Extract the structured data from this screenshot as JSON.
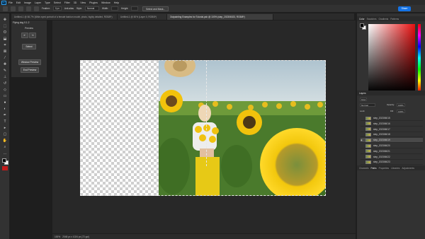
{
  "menubar": {
    "items": [
      "File",
      "Edit",
      "Image",
      "Layer",
      "Type",
      "Select",
      "Filter",
      "3D",
      "View",
      "Plugins",
      "Window",
      "Help"
    ]
  },
  "options": {
    "feather_label": "Feather:",
    "feather_value": "0 px",
    "antialias_label": "Anti-alias",
    "style_label": "Style:",
    "style_value": "Normal",
    "width_label": "Width:",
    "height_label": "Height:",
    "select_mask_label": "Select and Mask...",
    "share_label": "Share"
  },
  "tabs": [
    "Untitled-1 @ 66.7% (Wide-eyed portrait of a female fashion model, photo, highly detailed, RGB/8*)",
    "Untitled-1 @ 50% (Layer 0, RGB/8*)",
    "Outpainting Examples for Tutorial.psb @ 100% (step_202306023, RGB/8*)"
  ],
  "plugin": {
    "title": "Flying dog 0.1.2",
    "preview_label": "Preview",
    "select_label": "Select",
    "window_preview_label": "Window Preview",
    "end_preview_label": "End Preview"
  },
  "panels": {
    "color_tabs": [
      "Color",
      "Swatches",
      "Gradients",
      "Patterns"
    ],
    "layers_tabs": [
      "Layers"
    ],
    "blend_mode": "Normal",
    "opacity_label": "Opacity:",
    "opacity_value": "100%",
    "lock_label": "Lock:",
    "fill_label": "Fill:",
    "fill_value": "100%",
    "layers": [
      {
        "name": "step_202306015",
        "visible": false,
        "selected": false
      },
      {
        "name": "step_202306016",
        "visible": false,
        "selected": false
      },
      {
        "name": "step_202306017",
        "visible": false,
        "selected": false
      },
      {
        "name": "step_202306018",
        "visible": false,
        "selected": false
      },
      {
        "name": "step_202306019",
        "visible": true,
        "selected": true
      },
      {
        "name": "step_202306020",
        "visible": false,
        "selected": false
      },
      {
        "name": "step_202306021",
        "visible": false,
        "selected": false
      },
      {
        "name": "step_202306022",
        "visible": false,
        "selected": false
      },
      {
        "name": "step_202306023",
        "visible": false,
        "selected": false
      }
    ],
    "bottom_tabs": [
      "Channels",
      "Paths",
      "Properties",
      "Libraries",
      "Adjustments"
    ]
  },
  "status": {
    "zoom": "100%",
    "doc_size": "2048 px x 1024 px (72 ppi)"
  },
  "colors": {
    "foreground": "#000000",
    "background": "#ffffff",
    "accent": "#1473e6"
  }
}
